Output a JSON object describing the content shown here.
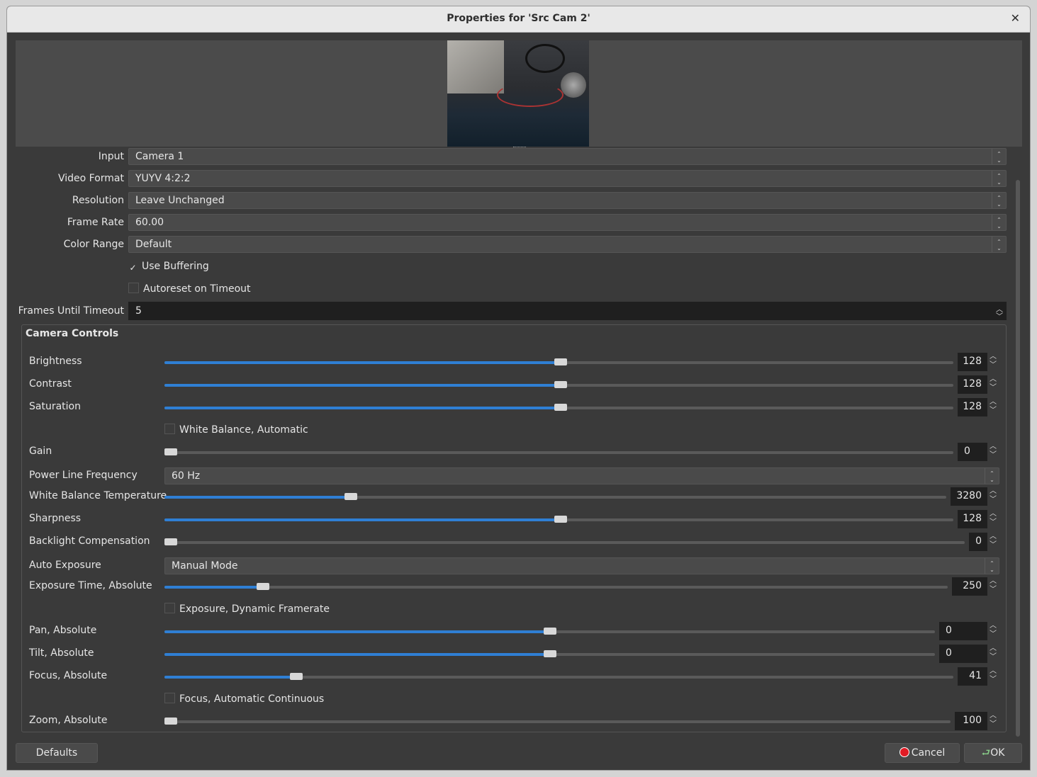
{
  "window": {
    "title": "Properties for 'Src Cam 2'",
    "close_icon": "✕"
  },
  "properties": {
    "input": {
      "label": "Input",
      "value": "Camera 1"
    },
    "video_format": {
      "label": "Video Format",
      "value": "YUYV 4:2:2"
    },
    "resolution": {
      "label": "Resolution",
      "value": "Leave Unchanged"
    },
    "frame_rate": {
      "label": "Frame Rate",
      "value": "60.00"
    },
    "color_range": {
      "label": "Color Range",
      "value": "Default"
    },
    "use_buffering": {
      "label": "Use Buffering",
      "checked": true
    },
    "autoreset": {
      "label": "Autoreset on Timeout",
      "checked": false
    },
    "frames_until_timeout": {
      "label": "Frames Until Timeout",
      "value": "5"
    }
  },
  "camera_controls": {
    "title": "Camera Controls",
    "brightness": {
      "label": "Brightness",
      "value": "128",
      "fraction": 0.502
    },
    "contrast": {
      "label": "Contrast",
      "value": "128",
      "fraction": 0.502
    },
    "saturation": {
      "label": "Saturation",
      "value": "128",
      "fraction": 0.502
    },
    "wb_auto": {
      "label": "White Balance, Automatic",
      "checked": false
    },
    "gain": {
      "label": "Gain",
      "value": "0",
      "fraction": 0.0
    },
    "power_line": {
      "label": "Power Line Frequency",
      "value": "60 Hz"
    },
    "wb_temp": {
      "label": "White Balance Temperature",
      "value": "3280",
      "fraction": 0.238
    },
    "sharpness": {
      "label": "Sharpness",
      "value": "128",
      "fraction": 0.502
    },
    "backlight": {
      "label": "Backlight Compensation",
      "value": "0",
      "fraction": 0.0
    },
    "auto_exposure": {
      "label": "Auto Exposure",
      "value": "Manual Mode"
    },
    "exposure_time": {
      "label": "Exposure Time, Absolute",
      "value": "250",
      "fraction": 0.126
    },
    "exposure_dyn": {
      "label": "Exposure, Dynamic Framerate",
      "checked": false
    },
    "pan": {
      "label": "Pan, Absolute",
      "value": "0",
      "fraction": 0.5
    },
    "tilt": {
      "label": "Tilt, Absolute",
      "value": "0",
      "fraction": 0.5
    },
    "focus": {
      "label": "Focus, Absolute",
      "value": "41",
      "fraction": 0.167
    },
    "focus_auto": {
      "label": "Focus, Automatic Continuous",
      "checked": false
    },
    "zoom": {
      "label": "Zoom, Absolute",
      "value": "100",
      "fraction": 0.0
    }
  },
  "buttons": {
    "defaults": "Defaults",
    "cancel": "Cancel",
    "ok": "OK"
  }
}
